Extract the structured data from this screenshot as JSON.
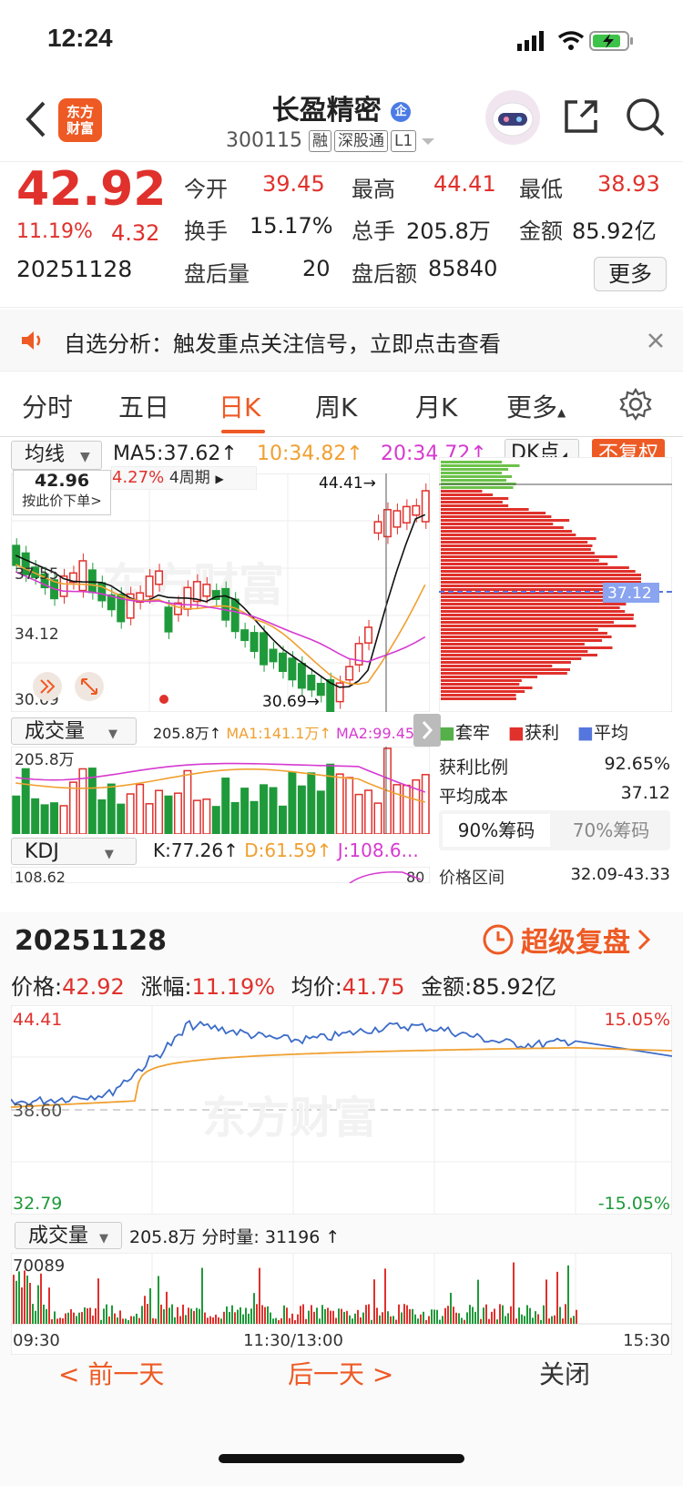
{
  "status_bar": {
    "time": "12:24"
  },
  "header": {
    "logo_text": "东方\n财富",
    "stock_name": "长盈精密",
    "badge": "企",
    "code": "300115",
    "tags": [
      "融",
      "深股通",
      "L1"
    ]
  },
  "quote": {
    "price": "42.92",
    "change_pct": "11.19%",
    "change_amt": "4.32",
    "date": "20251128",
    "fields": [
      {
        "label": "今开",
        "value": "39.45"
      },
      {
        "label": "最高",
        "value": "44.41"
      },
      {
        "label": "最低",
        "value": "38.93"
      },
      {
        "label": "换手",
        "value": "15.17%"
      },
      {
        "label": "总手",
        "value": "205.8万"
      },
      {
        "label": "金额",
        "value": "85.92亿"
      },
      {
        "label": "盘后量",
        "value": "20"
      },
      {
        "label": "盘后额",
        "value": "85840"
      }
    ],
    "more_label": "更多"
  },
  "notice": {
    "text": "自选分析：触发重点关注信号，立即点击查看"
  },
  "tabs": [
    "分时",
    "五日",
    "日K",
    "周K",
    "月K",
    "更多"
  ],
  "active_tab": "日K",
  "kline": {
    "indicator_select": "均线",
    "ma5": "MA5:37.62↑",
    "ma10": "10:34.82↑",
    "ma20": "20:34.72↑",
    "dk_label": "DK点",
    "adjust_btn": "不复权",
    "tooltip_price": "42.96",
    "tooltip_action": "按此价下单>",
    "period_pct": "4.27%",
    "period_label": "4周期",
    "high_mark": "44.41→",
    "low_mark": "30.69→",
    "y_labels": [
      "37.55",
      "34.12",
      "30.69"
    ],
    "chip_avg_label": "37.12",
    "volume_select": "成交量",
    "vol_text": "205.8万↑",
    "vol_ma1": "MA1:141.1万↑",
    "vol_ma2": "MA2:99.45...",
    "vol_axis": "205.8万",
    "kdj_select": "KDJ",
    "kdj_k": "K:77.26↑",
    "kdj_d": "D:61.59↑",
    "kdj_j": "J:108.6...",
    "kdj_axis": "108.62",
    "kdj_right": "80",
    "watermark": "东方财富"
  },
  "chips": {
    "legend": [
      "套牢",
      "获利",
      "平均"
    ],
    "profit_ratio_label": "获利比例",
    "profit_ratio": "92.65%",
    "avg_cost_label": "平均成本",
    "avg_cost": "37.12",
    "tab_90": "90%筹码",
    "tab_70": "70%筹码",
    "range_label": "价格区间",
    "range": "32.09-43.33"
  },
  "day_review": {
    "date": "20251128",
    "review_label": "超级复盘",
    "price_label": "价格:",
    "price": "42.92",
    "change_label": "涨幅:",
    "change": "11.19%",
    "avg_label": "均价:",
    "avg": "41.75",
    "amount_label": "金额:",
    "amount": "85.92亿",
    "y_top": "44.41",
    "y_mid": "38.60",
    "y_bot": "32.79",
    "pct_top": "15.05%",
    "pct_bot": "-15.05%",
    "vol_select": "成交量",
    "vol_text": "205.8万 分时量: 31196 ↑",
    "vol_axis": "70089",
    "time_start": "09:30",
    "time_mid": "11:30/13:00",
    "time_end": "15:30"
  },
  "bottom_nav": {
    "prev": "前一天",
    "next": "后一天",
    "close": "关闭"
  },
  "colors": {
    "up": "#e0312c",
    "down": "#1f9a3a",
    "accent": "#ee5a24",
    "ma10": "#f0a030",
    "ma20": "#d63ad0"
  }
}
